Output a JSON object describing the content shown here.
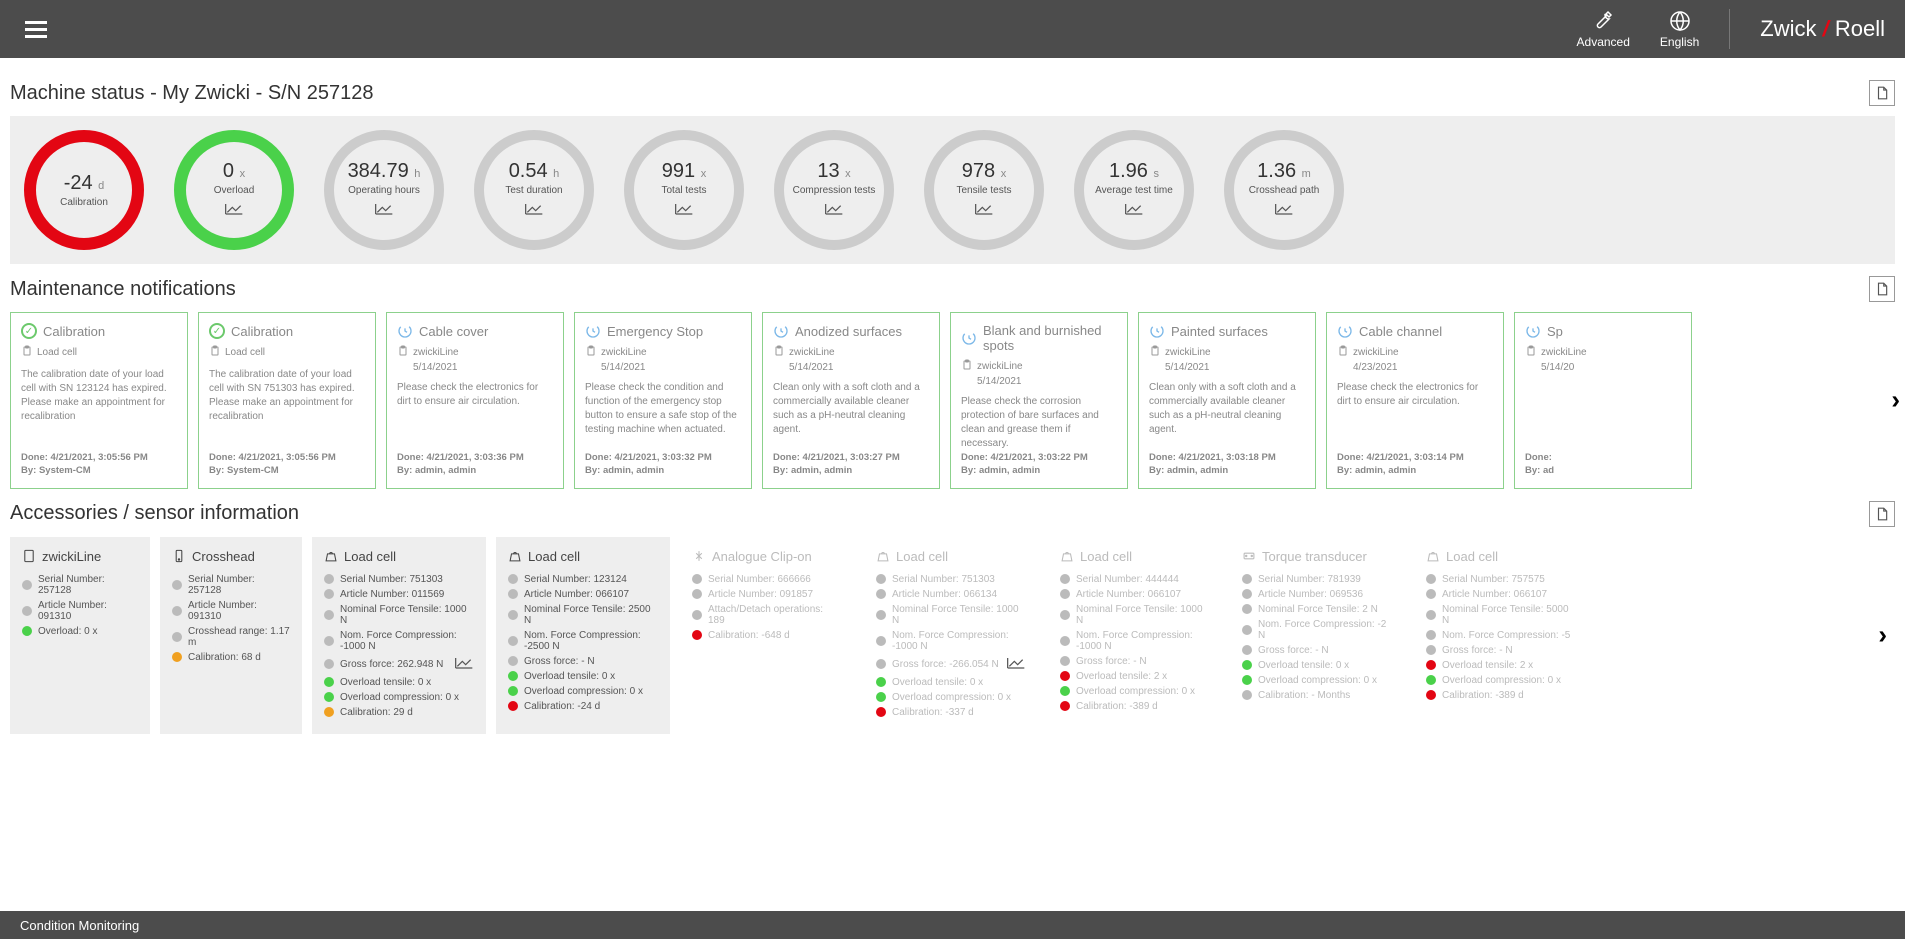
{
  "header": {
    "advanced": "Advanced",
    "language": "English",
    "logo_part1": "Zwick",
    "logo_part2": "Roell"
  },
  "page_title": "Machine status - My Zwicki - S/N 257128",
  "gauges": [
    {
      "value": "-24",
      "unit": "d",
      "label": "Calibration",
      "style": "red",
      "icon": false
    },
    {
      "value": "0",
      "unit": "x",
      "label": "Overload",
      "style": "green",
      "icon": true
    },
    {
      "value": "384.79",
      "unit": "h",
      "label": "Operating hours",
      "style": "gray",
      "icon": true
    },
    {
      "value": "0.54",
      "unit": "h",
      "label": "Test duration",
      "style": "gray",
      "icon": true
    },
    {
      "value": "991",
      "unit": "x",
      "label": "Total tests",
      "style": "gray",
      "icon": true
    },
    {
      "value": "13",
      "unit": "x",
      "label": "Compression tests",
      "style": "gray",
      "icon": true
    },
    {
      "value": "978",
      "unit": "x",
      "label": "Tensile tests",
      "style": "gray",
      "icon": true
    },
    {
      "value": "1.96",
      "unit": "s",
      "label": "Average test time",
      "style": "gray",
      "icon": true
    },
    {
      "value": "1.36",
      "unit": "m",
      "label": "Crosshead path",
      "style": "gray",
      "icon": true
    }
  ],
  "notifications_title": "Maintenance notifications",
  "notifications": [
    {
      "type": "check",
      "title": "Calibration",
      "sub": "Load cell",
      "date": "",
      "text": "The calibration date of your load cell with SN 123124 has expired. Please make an appointment for recalibration",
      "done": "Done: 4/21/2021, 3:05:56 PM",
      "by": "By: System-CM"
    },
    {
      "type": "check",
      "title": "Calibration",
      "sub": "Load cell",
      "date": "",
      "text": "The calibration date of your load cell with SN 751303 has expired. Please make an appointment for recalibration",
      "done": "Done: 4/21/2021, 3:05:56 PM",
      "by": "By: System-CM"
    },
    {
      "type": "calendar",
      "title": "Cable cover",
      "sub": "zwickiLine",
      "date": "5/14/2021",
      "text": "Please check the electronics for dirt to ensure air circulation.",
      "done": "Done: 4/21/2021, 3:03:36 PM",
      "by": "By: admin, admin"
    },
    {
      "type": "calendar",
      "title": "Emergency Stop",
      "sub": "zwickiLine",
      "date": "5/14/2021",
      "text": "Please check the condition and function of the emergency stop button to ensure a safe stop of the testing machine when actuated.",
      "done": "Done: 4/21/2021, 3:03:32 PM",
      "by": "By: admin, admin"
    },
    {
      "type": "calendar",
      "title": "Anodized surfaces",
      "sub": "zwickiLine",
      "date": "5/14/2021",
      "text": "Clean only with a soft cloth and a commercially available cleaner such as a pH-neutral cleaning agent.",
      "done": "Done: 4/21/2021, 3:03:27 PM",
      "by": "By: admin, admin"
    },
    {
      "type": "calendar",
      "title": "Blank and burnished spots",
      "sub": "zwickiLine",
      "date": "5/14/2021",
      "text": "Please check the corrosion protection of bare surfaces and clean and grease them if necessary.",
      "done": "Done: 4/21/2021, 3:03:22 PM",
      "by": "By: admin, admin"
    },
    {
      "type": "calendar",
      "title": "Painted surfaces",
      "sub": "zwickiLine",
      "date": "5/14/2021",
      "text": "Clean only with a soft cloth and a commercially available cleaner such as a pH-neutral cleaning agent.",
      "done": "Done: 4/21/2021, 3:03:18 PM",
      "by": "By: admin, admin"
    },
    {
      "type": "calendar",
      "title": "Cable channel",
      "sub": "zwickiLine",
      "date": "4/23/2021",
      "text": "Please check the electronics for dirt to ensure air circulation.",
      "done": "Done: 4/21/2021, 3:03:14 PM",
      "by": "By: admin, admin"
    },
    {
      "type": "calendar",
      "title": "Sp",
      "sub": "zwickiLine",
      "date": "5/14/20",
      "text": "",
      "done": "Done:",
      "by": "By: ad"
    }
  ],
  "accessories_title": "Accessories / sensor information",
  "accessories": [
    {
      "title": "zwickiLine",
      "width": "w140",
      "active": true,
      "rows": [
        {
          "dot": "gray",
          "text": "Serial Number: 257128"
        },
        {
          "dot": "gray",
          "text": "Article Number: 091310"
        },
        {
          "dot": "green",
          "text": "Overload: 0 x"
        }
      ]
    },
    {
      "title": "Crosshead",
      "width": "w142",
      "active": true,
      "rows": [
        {
          "dot": "gray",
          "text": "Serial Number: 257128"
        },
        {
          "dot": "gray",
          "text": "Article Number: 091310"
        },
        {
          "dot": "gray",
          "text": "Crosshead range: 1.17 m"
        },
        {
          "dot": "orange",
          "text": "Calibration: 68 d"
        }
      ]
    },
    {
      "title": "Load cell",
      "width": "w168",
      "active": true,
      "rows": [
        {
          "dot": "gray",
          "text": "Serial Number: 751303"
        },
        {
          "dot": "gray",
          "text": "Article Number: 011569"
        },
        {
          "dot": "gray",
          "text": "Nominal Force Tensile: 1000 N"
        },
        {
          "dot": "gray",
          "text": "Nom. Force Compression: -1000 N"
        },
        {
          "dot": "gray",
          "text": "Gross force: 262.948 N",
          "chart": true
        },
        {
          "dot": "green",
          "text": "Overload tensile: 0 x"
        },
        {
          "dot": "green",
          "text": "Overload compression: 0 x"
        },
        {
          "dot": "orange",
          "text": "Calibration: 29 d"
        }
      ]
    },
    {
      "title": "Load cell",
      "width": "w168",
      "active": true,
      "rows": [
        {
          "dot": "gray",
          "text": "Serial Number: 123124"
        },
        {
          "dot": "gray",
          "text": "Article Number: 066107"
        },
        {
          "dot": "gray",
          "text": "Nominal Force Tensile: 2500 N"
        },
        {
          "dot": "gray",
          "text": "Nom. Force Compression: -2500 N"
        },
        {
          "dot": "gray",
          "text": "Gross force: - N"
        },
        {
          "dot": "green",
          "text": "Overload tensile: 0 x"
        },
        {
          "dot": "green",
          "text": "Overload compression: 0 x"
        },
        {
          "dot": "red",
          "text": "Calibration: -24 d"
        }
      ]
    },
    {
      "title": "Analogue Clip-on",
      "width": "w168",
      "active": false,
      "rows": [
        {
          "dot": "gray",
          "text": "Serial Number: 666666"
        },
        {
          "dot": "gray",
          "text": "Article Number: 091857"
        },
        {
          "dot": "gray",
          "text": "Attach/Detach operations: 189"
        },
        {
          "dot": "red",
          "text": "Calibration: -648 d"
        }
      ]
    },
    {
      "title": "Load cell",
      "width": "w168",
      "active": false,
      "rows": [
        {
          "dot": "gray",
          "text": "Serial Number: 751303"
        },
        {
          "dot": "gray",
          "text": "Article Number: 066134"
        },
        {
          "dot": "gray",
          "text": "Nominal Force Tensile: 1000 N"
        },
        {
          "dot": "gray",
          "text": "Nom. Force Compression: -1000 N"
        },
        {
          "dot": "gray",
          "text": "Gross force: -266.054 N",
          "chart": true
        },
        {
          "dot": "green",
          "text": "Overload tensile: 0 x"
        },
        {
          "dot": "green",
          "text": "Overload compression: 0 x"
        },
        {
          "dot": "red",
          "text": "Calibration: -337 d"
        }
      ]
    },
    {
      "title": "Load cell",
      "width": "w170",
      "active": false,
      "rows": [
        {
          "dot": "gray",
          "text": "Serial Number: 444444"
        },
        {
          "dot": "gray",
          "text": "Article Number: 066107"
        },
        {
          "dot": "gray",
          "text": "Nominal Force Tensile: 1000 N"
        },
        {
          "dot": "gray",
          "text": "Nom. Force Compression: -1000 N"
        },
        {
          "dot": "gray",
          "text": "Gross force: - N"
        },
        {
          "dot": "red",
          "text": "Overload tensile: 2 x"
        },
        {
          "dot": "green",
          "text": "Overload compression: 0 x"
        },
        {
          "dot": "red",
          "text": "Calibration: -389 d"
        }
      ]
    },
    {
      "title": "Torque transducer",
      "width": "w168",
      "active": false,
      "rows": [
        {
          "dot": "gray",
          "text": "Serial Number: 781939"
        },
        {
          "dot": "gray",
          "text": "Article Number: 069536"
        },
        {
          "dot": "gray",
          "text": "Nominal Force Tensile: 2 N"
        },
        {
          "dot": "gray",
          "text": "Nom. Force Compression: -2 N"
        },
        {
          "dot": "gray",
          "text": "Gross force: - N"
        },
        {
          "dot": "green",
          "text": "Overload tensile: 0 x"
        },
        {
          "dot": "green",
          "text": "Overload compression: 0 x"
        },
        {
          "dot": "gray",
          "text": "Calibration: - Months"
        }
      ]
    },
    {
      "title": "Load cell",
      "width": "w168",
      "active": false,
      "rows": [
        {
          "dot": "gray",
          "text": "Serial Number: 757575"
        },
        {
          "dot": "gray",
          "text": "Article Number: 066107"
        },
        {
          "dot": "gray",
          "text": "Nominal Force Tensile: 5000 N"
        },
        {
          "dot": "gray",
          "text": "Nom. Force Compression: -5"
        },
        {
          "dot": "gray",
          "text": "Gross force: - N"
        },
        {
          "dot": "red",
          "text": "Overload tensile: 2 x"
        },
        {
          "dot": "green",
          "text": "Overload compression: 0 x"
        },
        {
          "dot": "red",
          "text": "Calibration: -389 d"
        }
      ]
    }
  ],
  "footer": "Condition Monitoring"
}
